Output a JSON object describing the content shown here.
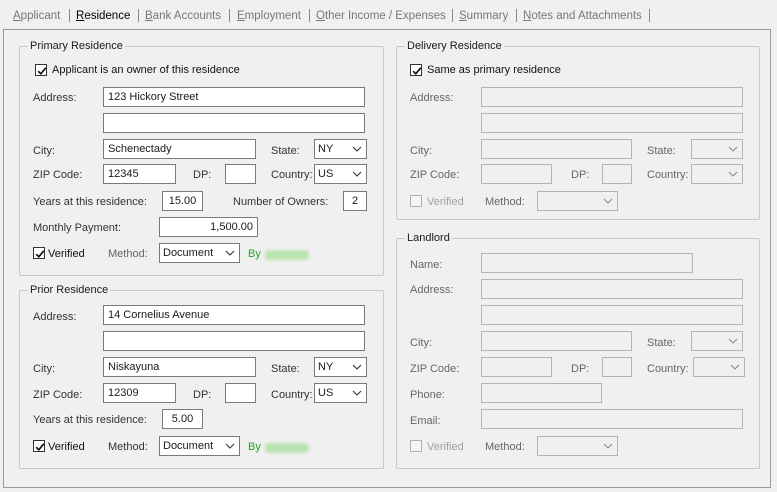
{
  "tabs": [
    {
      "pre": "",
      "u": "A",
      "post": "pplicant"
    },
    {
      "pre": "",
      "u": "R",
      "post": "esidence"
    },
    {
      "pre": "",
      "u": "B",
      "post": "ank Accounts"
    },
    {
      "pre": "",
      "u": "E",
      "post": "mployment"
    },
    {
      "pre": "",
      "u": "O",
      "post": "ther Income / Expenses"
    },
    {
      "pre": "",
      "u": "S",
      "post": "ummary"
    },
    {
      "pre": "",
      "u": "N",
      "post": "otes and Attachments"
    }
  ],
  "primary": {
    "legend": "Primary Residence",
    "owner_label": "Applicant is an owner of this residence",
    "owner_checked": true,
    "address_label": "Address:",
    "address1": "123 Hickory Street",
    "address2": "",
    "city_label": "City:",
    "city": "Schenectady",
    "state_label": "State:",
    "state": "NY",
    "zip_label": "ZIP Code:",
    "zip": "12345",
    "dp_label": "DP:",
    "dp": "",
    "country_label": "Country:",
    "country": "US",
    "years_label": "Years at this residence:",
    "years": "15.00",
    "owners_label": "Number of Owners:",
    "owners": "2",
    "payment_label": "Monthly Payment:",
    "payment": "1,500.00",
    "verified_label": "Verified",
    "verified_checked": true,
    "method_label": "Method:",
    "method": "Document",
    "by_label": "By"
  },
  "prior": {
    "legend": "Prior Residence",
    "address_label": "Address:",
    "address1": "14 Cornelius Avenue",
    "address2": "",
    "city_label": "City:",
    "city": "Niskayuna",
    "state_label": "State:",
    "state": "NY",
    "zip_label": "ZIP Code:",
    "zip": "12309",
    "dp_label": "DP:",
    "dp": "",
    "country_label": "Country:",
    "country": "US",
    "years_label": "Years at this residence:",
    "years": "5.00",
    "verified_label": "Verified",
    "verified_checked": true,
    "method_label": "Method:",
    "method": "Document",
    "by_label": "By"
  },
  "delivery": {
    "legend": "Delivery Residence",
    "same_label": "Same as primary residence",
    "same_checked": true,
    "address_label": "Address:",
    "city_label": "City:",
    "state_label": "State:",
    "zip_label": "ZIP Code:",
    "dp_label": "DP:",
    "country_label": "Country:",
    "verified_label": "Verified",
    "method_label": "Method:"
  },
  "landlord": {
    "legend": "Landlord",
    "name_label": "Name:",
    "address_label": "Address:",
    "city_label": "City:",
    "state_label": "State:",
    "zip_label": "ZIP Code:",
    "dp_label": "DP:",
    "country_label": "Country:",
    "phone_label": "Phone:",
    "email_label": "Email:",
    "verified_label": "Verified",
    "method_label": "Method:"
  },
  "colors": {
    "window_bg": "#f0f0f0",
    "group_border": "#c8c8c8",
    "verified_by_text": "#2a9a2a",
    "inactive_tab": "#777777"
  }
}
